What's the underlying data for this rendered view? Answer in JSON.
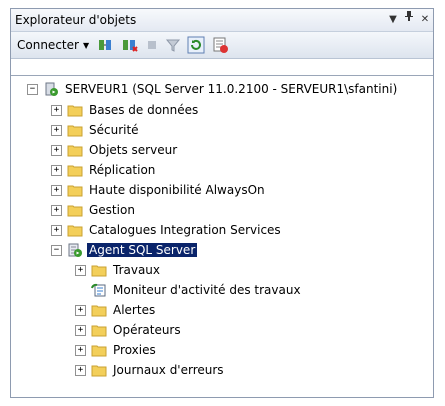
{
  "window": {
    "title": "Explorateur d'objets",
    "pin_glyph": "▾",
    "dock_glyph": "ꟸ",
    "close_glyph": "×"
  },
  "toolbar": {
    "connect_label": "Connecter",
    "caret": "▾"
  },
  "tree": {
    "server": {
      "expander": "⊟",
      "label": "SERVEUR1 (SQL Server 11.0.2100 - SERVEUR1\\sfantini)"
    },
    "items": [
      {
        "label": "Bases de données",
        "expander": "+"
      },
      {
        "label": "Sécurité",
        "expander": "+"
      },
      {
        "label": "Objets serveur",
        "expander": "+"
      },
      {
        "label": "Réplication",
        "expander": "+"
      },
      {
        "label": "Haute disponibilité AlwaysOn",
        "expander": "+"
      },
      {
        "label": "Gestion",
        "expander": "+"
      },
      {
        "label": "Catalogues Integration Services",
        "expander": "+"
      },
      {
        "label": "Agent SQL Server",
        "expander": "−"
      }
    ],
    "agent_children": [
      {
        "label": "Travaux",
        "expander": "+"
      },
      {
        "label": "Moniteur d'activité des travaux",
        "expander": ""
      },
      {
        "label": "Alertes",
        "expander": "+"
      },
      {
        "label": "Opérateurs",
        "expander": "+"
      },
      {
        "label": "Proxies",
        "expander": "+"
      },
      {
        "label": "Journaux d'erreurs",
        "expander": "+"
      }
    ]
  },
  "colors": {
    "selection": "#0a246a",
    "folder": "#f3cf5a",
    "server_green": "#3a9a2e"
  }
}
